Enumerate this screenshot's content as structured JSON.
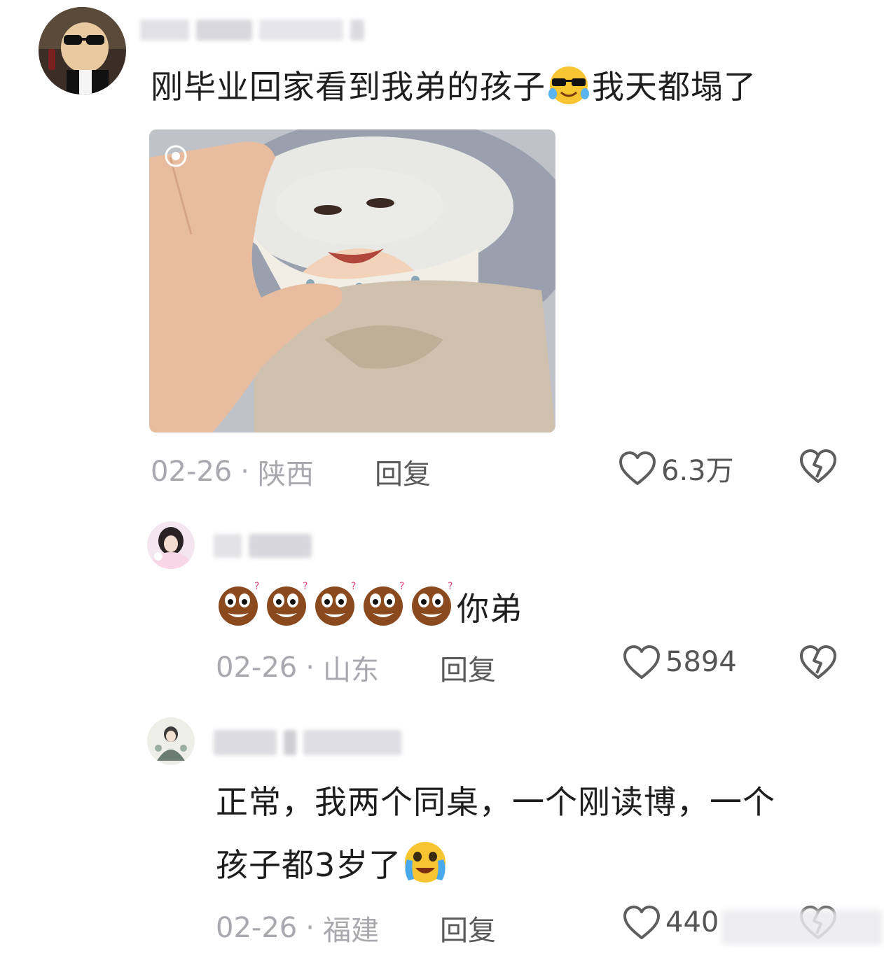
{
  "comments": [
    {
      "username": "",
      "text_before": "刚毕业回家看到我弟的孩子",
      "text_after": "我天都塌了",
      "emoji": "sunglasses-crying-emoji",
      "date": "02-26",
      "location": "陕西",
      "reply_label": "回复",
      "likes": "6.3万",
      "has_image": true
    },
    {
      "username": "",
      "emojis": [
        "confused-cookie-emoji",
        "confused-cookie-emoji",
        "confused-cookie-emoji",
        "confused-cookie-emoji",
        "confused-cookie-emoji"
      ],
      "text": "你弟",
      "date": "02-26",
      "location": "山东",
      "reply_label": "回复",
      "likes": "5894"
    },
    {
      "username": "",
      "line1": "正常，我两个同桌，一个刚读博，一个",
      "line2": "孩子都3岁了",
      "emoji": "crying-face-emoji",
      "date": "02-26",
      "location": "福建",
      "reply_label": "回复",
      "likes": "440"
    }
  ],
  "separator": "·",
  "icons": {
    "like": "heart-outline-icon",
    "dislike": "broken-heart-icon"
  }
}
